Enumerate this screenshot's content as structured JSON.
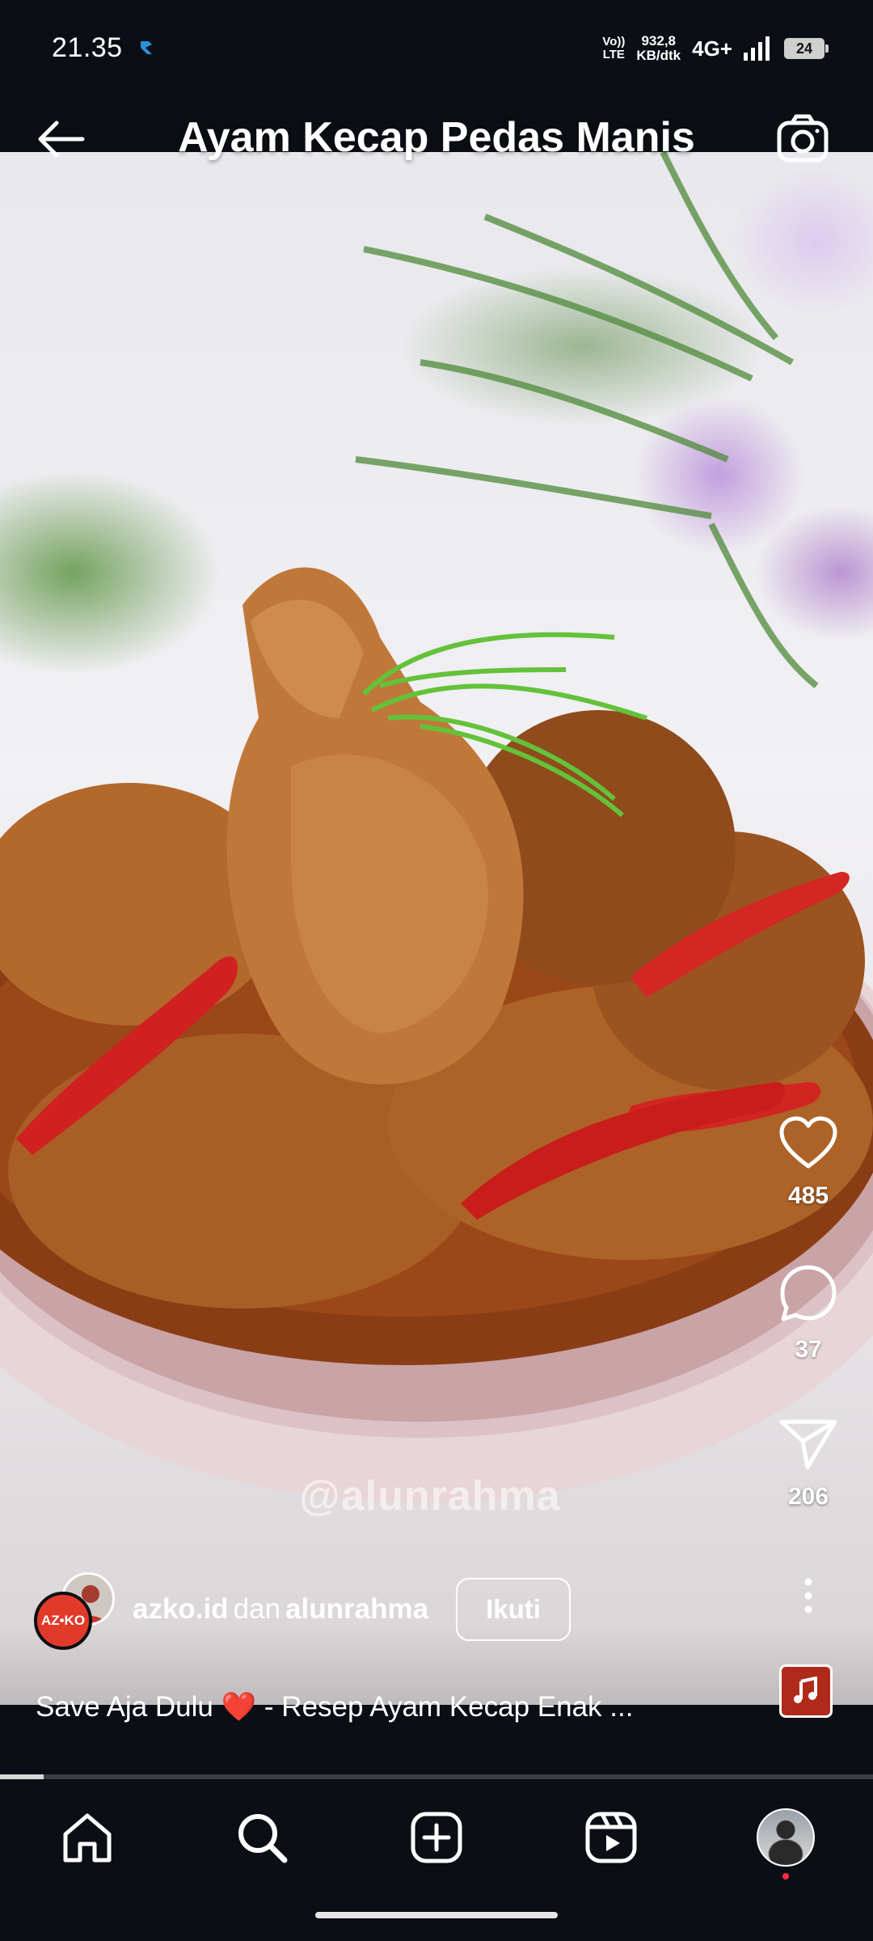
{
  "status_bar": {
    "time": "21.35",
    "volte_top": "Vo))",
    "volte_bottom": "LTE",
    "speed_value": "932,8",
    "speed_unit": "KB/dtk",
    "network": "4G+",
    "battery": "24"
  },
  "header": {
    "title": "Ayam Kecap Pedas Manis",
    "back_icon": "arrow-left-icon",
    "camera_icon": "camera-icon"
  },
  "media": {
    "watermark": "@alunrahma"
  },
  "actions": {
    "likes": "485",
    "comments": "37",
    "shares": "206"
  },
  "post": {
    "author_primary": "azko.id",
    "author_joiner": "dan",
    "author_secondary": "alunrahma",
    "avatar_label": "AZ•KO",
    "follow_label": "Ikuti",
    "caption_before": "Save Aja Dulu ",
    "caption_emoji": "❤️",
    "caption_after": " - Resep Ayam Kecap Enak ..."
  },
  "progress": {
    "fraction": 0.05
  },
  "colors": {
    "background": "#0b0f15",
    "accent_red": "#e23a2a",
    "notification": "#ff3040"
  },
  "nav": {
    "items": [
      "home-icon",
      "search-icon",
      "create-icon",
      "reels-icon",
      "profile-avatar"
    ]
  }
}
